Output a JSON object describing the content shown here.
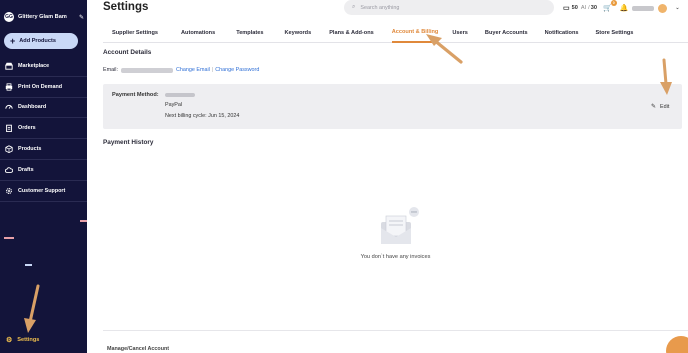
{
  "sidebar": {
    "brand": {
      "initials": "GG",
      "name": "Glittery Glam Bam"
    },
    "add_button": {
      "label": "Add Products"
    },
    "items": [
      {
        "label": "Marketplace",
        "icon": "storefront-icon"
      },
      {
        "label": "Print On Demand",
        "icon": "printer-icon"
      },
      {
        "label": "Dashboard",
        "icon": "gauge-icon"
      },
      {
        "label": "Orders",
        "icon": "clipboard-icon"
      },
      {
        "label": "Products",
        "icon": "box-icon"
      },
      {
        "label": "Drafts",
        "icon": "cloud-icon"
      },
      {
        "label": "Customer Support",
        "icon": "gear-icon"
      }
    ],
    "settings_label": "Settings"
  },
  "header": {
    "title": "Settings",
    "search_placeholder": "Search anything",
    "credits": "50",
    "ai_label": "AI",
    "ai_credits": "30",
    "cart_badge": "0"
  },
  "tabs": [
    {
      "label": "Supplier Settings",
      "active": false
    },
    {
      "label": "Automations",
      "active": false
    },
    {
      "label": "Templates",
      "active": false
    },
    {
      "label": "Keywords",
      "active": false
    },
    {
      "label": "Plans & Add-ons",
      "active": false
    },
    {
      "label": "Account & Billing",
      "active": true
    },
    {
      "label": "Users",
      "active": false
    },
    {
      "label": "Buyer Accounts",
      "active": false
    },
    {
      "label": "Notifications",
      "active": false
    },
    {
      "label": "Store Settings",
      "active": false
    }
  ],
  "account": {
    "heading": "Account Details",
    "email_label": "Email:",
    "change_email": "Change Email",
    "separator": "|",
    "change_password": "Change Password",
    "payment_label": "Payment Method:",
    "payment_type": "PayPal",
    "next_billing": "Next billing cycle: Jun 15, 2024",
    "edit_label": "Edit"
  },
  "payment_history": {
    "heading": "Payment History",
    "empty_text": "You don`t have any invoices"
  },
  "manage": {
    "label": "Manage/Cancel Account"
  },
  "colors": {
    "sidebar_bg": "#13143a",
    "accent": "#e0893b",
    "link": "#2f6fd6",
    "add_button_bg": "#c9d8f7",
    "settings_active": "#f2c14e"
  }
}
